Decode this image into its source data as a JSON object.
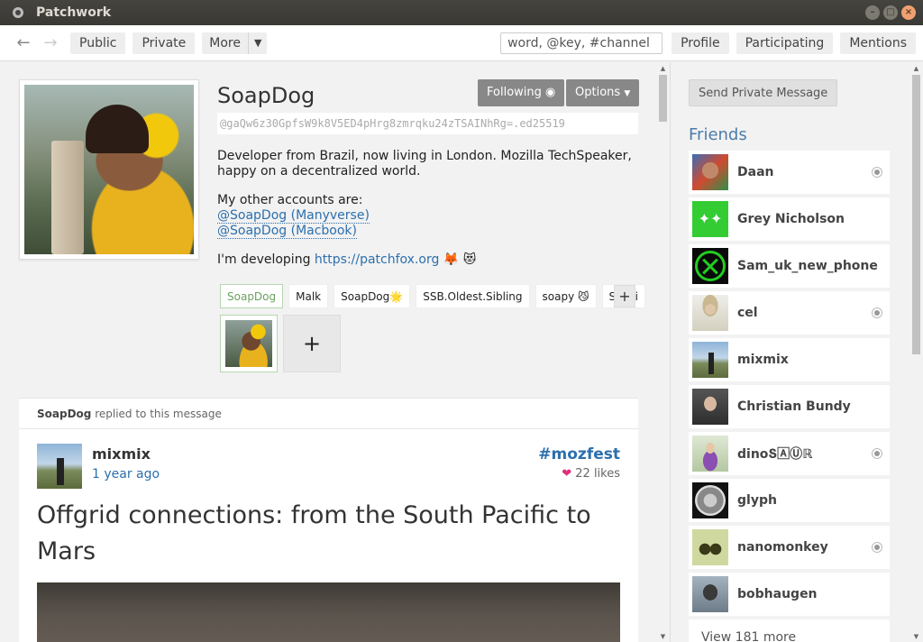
{
  "window": {
    "title": "Patchwork"
  },
  "toolbar": {
    "public": "Public",
    "private": "Private",
    "more": "More",
    "search_placeholder": "word, @key, #channel",
    "profile": "Profile",
    "participating": "Participating",
    "mentions": "Mentions"
  },
  "profile": {
    "name": "SoapDog",
    "following_label": "Following",
    "options_label": "Options",
    "feed_id": "@gaQw6z30GpfsW9k8V5ED4pHrg8zmrqku24zTSAINhRg=.ed25519",
    "bio_line1": "Developer from Brazil, now living in London. Mozilla TechSpeaker, happy on a decentralized world.",
    "bio_line2": "My other accounts are:",
    "link1": "@SoapDog (Manyverse)",
    "link2": "@SoapDog (Macbook)",
    "bio_line3_prefix": "I'm developing ",
    "bio_link3": "https://patchfox.org",
    "bio_emoji": "🦊 😻",
    "names": [
      "SoapDog",
      "Malk",
      "SoapDog🌟",
      "SSB.Oldest.Sibling",
      "soapy 😼",
      "Sushi"
    ],
    "add_label": "+"
  },
  "post": {
    "reply_author": "SoapDog",
    "reply_text": " replied to this message",
    "author": "mixmix",
    "time": "1 year ago",
    "channel": "#mozfest",
    "heart": "❤",
    "likes": "22 likes",
    "title": "Offgrid connections: from the South Pacific to Mars"
  },
  "sidebar": {
    "pm_button": "Send Private Message",
    "friends_title": "Friends",
    "friends": [
      {
        "name": "Daan",
        "dot": true,
        "color": "#6b4b3a"
      },
      {
        "name": "Grey Nicholson",
        "dot": false,
        "color": "#33cc33"
      },
      {
        "name": "Sam_uk_new_phone",
        "dot": false,
        "color": "#111111"
      },
      {
        "name": "cel",
        "dot": true,
        "color": "#d8d2bf"
      },
      {
        "name": "mixmix",
        "dot": false,
        "color": "#7b9bc4"
      },
      {
        "name": "Christian Bundy",
        "dot": false,
        "color": "#4a4a4a"
      },
      {
        "name": "dinoՏ🄰Ⓤℝ",
        "dot": true,
        "color": "#b7a7cf"
      },
      {
        "name": "glyph",
        "dot": false,
        "color": "#9a9a9a"
      },
      {
        "name": "nanomonkey",
        "dot": true,
        "color": "#c8d49a"
      },
      {
        "name": "bobhaugen",
        "dot": false,
        "color": "#7b8a96"
      }
    ],
    "view_more": "View 181 more"
  }
}
